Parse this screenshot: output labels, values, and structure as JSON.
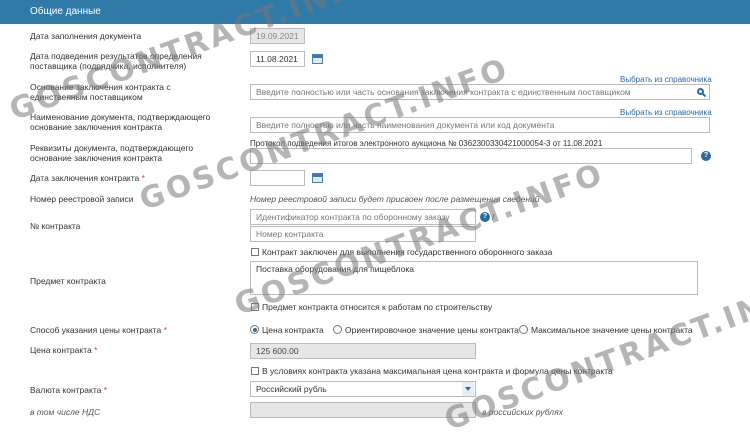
{
  "header": {
    "title": "Общие данные"
  },
  "fields": {
    "fill_date": {
      "label": "Дата заполнения документа",
      "value": "19.09.2021"
    },
    "supplier_date": {
      "label": "Дата подведения результатов определения поставщика (подрядчика, исполнителя)",
      "value": "11.08.2021"
    },
    "single_supplier": {
      "label": "Основание заключения контракта с единственным поставщиком",
      "link": "Выбрать из справочника",
      "placeholder": "Введите полностью или часть основания заключения контракта с единственным поставщиком"
    },
    "doc_name": {
      "label": "Наименование документа, подтверждающего основание заключения контракта",
      "link": "Выбрать из справочника",
      "placeholder": "Введите полностью или часть наименования документа или код документа"
    },
    "doc_details": {
      "label": "Реквизиты документа, подтверждающего основание заключения контракта",
      "value": "Протокол подведения итогов электронного аукциона № 0362300330421000054-3 от 11.08.2021"
    },
    "contract_date": {
      "label": "Дата заключения контракта",
      "required": "*"
    },
    "registry_number": {
      "label": "Номер реестровой записи",
      "value": "Номер реестровой записи будет присвоен после размещения сведений"
    },
    "contract_number": {
      "label": "№ контракта",
      "defense_placeholder": "Идентификатор контракта по оборонному заказу",
      "separator": "/",
      "number_placeholder": "Номер контракта"
    },
    "subject": {
      "label": "Предмет контракта",
      "check_defense": "Контракт заключен для выполнения государственного оборонного заказа",
      "value": "Поставка оборудования для пищеблока",
      "check_construction": "Предмет контракта относится к работам по строительству"
    },
    "price_method": {
      "label": "Способ указания цены контракта",
      "required": "*",
      "options": [
        "Цена контракта",
        "Ориентировочное значение цены контракта",
        "Максимальное значение цены контракта"
      ]
    },
    "price": {
      "label": "Цена контракта",
      "required": "*",
      "value": "125 600.00",
      "check_max": "В условиях контракта указана максимальная цена контракта и формула цены контракта"
    },
    "currency": {
      "label": "Валюта контракта",
      "required": "*",
      "value": "Российский рубль"
    },
    "vat": {
      "label": "в том числе НДС",
      "unit": "в российских рублях"
    }
  },
  "watermark": "GOSCONTRACT.INFO"
}
